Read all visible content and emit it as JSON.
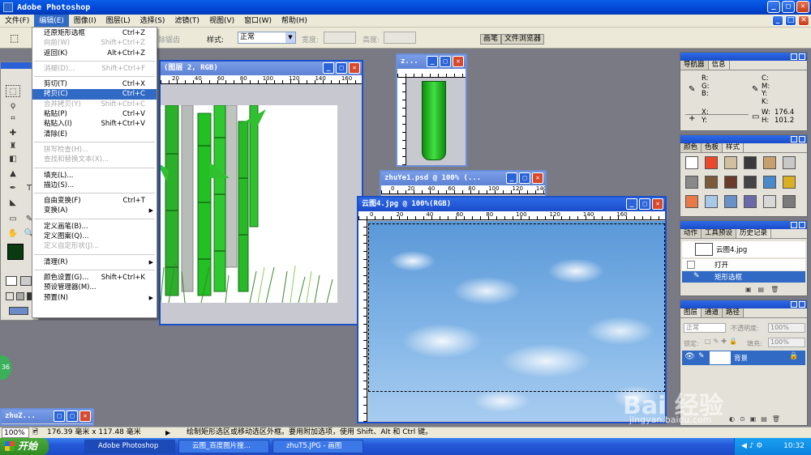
{
  "app": {
    "title": "Adobe Photoshop"
  },
  "menubar": [
    "文件(F)",
    "编辑(E)",
    "图像(I)",
    "图层(L)",
    "选择(S)",
    "滤镜(T)",
    "视图(V)",
    "窗口(W)",
    "帮助(H)"
  ],
  "options": {
    "feather_label": "除锯齿",
    "style_label": "样式:",
    "style_value": "正常",
    "width_label": "宽度:",
    "height_label": "高度:",
    "tab_brushes": "画笔",
    "tab_browser": "文件浏览器"
  },
  "edit_menu": {
    "g1": [
      {
        "label": "还原矩形选框",
        "sc": "Ctrl+Z"
      },
      {
        "label": "向前(W)",
        "sc": "Shift+Ctrl+Z",
        "disabled": true
      },
      {
        "label": "返回(K)",
        "sc": "Alt+Ctrl+Z"
      }
    ],
    "g2": [
      {
        "label": "消褪(D)...",
        "sc": "Shift+Ctrl+F",
        "disabled": true
      }
    ],
    "g3": [
      {
        "label": "剪切(T)",
        "sc": "Ctrl+X"
      },
      {
        "label": "拷贝(C)",
        "sc": "Ctrl+C",
        "hl": true
      },
      {
        "label": "合并拷贝(Y)",
        "sc": "Shift+Ctrl+C",
        "disabled": true
      },
      {
        "label": "粘贴(P)",
        "sc": "Ctrl+V"
      },
      {
        "label": "粘贴入(I)",
        "sc": "Shift+Ctrl+V"
      },
      {
        "label": "清除(E)",
        "sc": ""
      }
    ],
    "g4": [
      {
        "label": "拼写检查(H)...",
        "sc": "",
        "disabled": true
      },
      {
        "label": "查找和替换文本(X)...",
        "sc": "",
        "disabled": true
      }
    ],
    "g5": [
      {
        "label": "填充(L)...",
        "sc": ""
      },
      {
        "label": "描边(S)...",
        "sc": ""
      }
    ],
    "g6": [
      {
        "label": "自由变换(F)",
        "sc": "Ctrl+T"
      },
      {
        "label": "变换(A)",
        "sc": "",
        "sub": true
      }
    ],
    "g7": [
      {
        "label": "定义画笔(B)...",
        "sc": ""
      },
      {
        "label": "定义图案(Q)...",
        "sc": ""
      },
      {
        "label": "定义自定形状(J)...",
        "sc": "",
        "disabled": true
      }
    ],
    "g8": [
      {
        "label": "清理(R)",
        "sc": "",
        "sub": true
      }
    ],
    "g9": [
      {
        "label": "颜色设置(G)...",
        "sc": "Shift+Ctrl+K"
      },
      {
        "label": "预设管理器(M)...",
        "sc": ""
      },
      {
        "label": "预置(N)",
        "sc": "",
        "sub": true
      }
    ]
  },
  "windows": {
    "layer2_title": "(图层 2, RGB)",
    "small_title": "z...",
    "zhuye_title": "zhuYe1.psd @ 100% (...",
    "yuntu_title": "云图4.jpg @ 100%(RGB)",
    "minimized_title": "zhuZ...",
    "yuntu_rulers": [
      "0",
      "20",
      "40",
      "60",
      "80",
      "100",
      "120",
      "140",
      "160"
    ],
    "zhuye_rulers": [
      "0",
      "20",
      "40",
      "60",
      "80",
      "100",
      "120",
      "140",
      "160"
    ],
    "layer2_rulers": [
      "20",
      "40",
      "60",
      "80",
      "100",
      "120",
      "140",
      "160"
    ]
  },
  "info_panel": {
    "tabs": [
      "导航器",
      "信息"
    ],
    "rgb": "R:\nG:\nB:",
    "cmyk": "C:\nM:\nY:\nK:",
    "xy": "X:\nY:",
    "wh_labels": "W:\nH:",
    "w": "176.4",
    "h": "101.2"
  },
  "color_panel": {
    "tabs": [
      "颜色",
      "色板",
      "样式"
    ]
  },
  "history_panel": {
    "tabs": [
      "动作",
      "工具预设",
      "历史记录"
    ],
    "snapshot": "云图4.jpg",
    "items": [
      "打开",
      "矩形选框"
    ]
  },
  "layers_panel": {
    "tabs": [
      "图层",
      "通道",
      "路径"
    ],
    "blend": "正常",
    "opacity_label": "不透明度:",
    "opacity": "100%",
    "lock_label": "锁定:",
    "fill_label": "填充:",
    "fill": "100%",
    "layer_name": "背景"
  },
  "status": {
    "zoom": "100%",
    "doc_size": "176.39 毫米 x 117.48 毫米",
    "hint": "绘制矩形选区或移动选区外框。要用附加选项，使用 Shift、Alt 和 Ctrl 键。"
  },
  "taskbar": {
    "start": "开始",
    "items": [
      "Adobe Photoshop",
      "云图_百度图片搜...",
      "zhuT5.JPG - 画图"
    ],
    "clock": "10:32"
  },
  "watermark": {
    "brand": "Bai 经验",
    "url": "jingyan.baidu.com"
  },
  "badge": "36"
}
